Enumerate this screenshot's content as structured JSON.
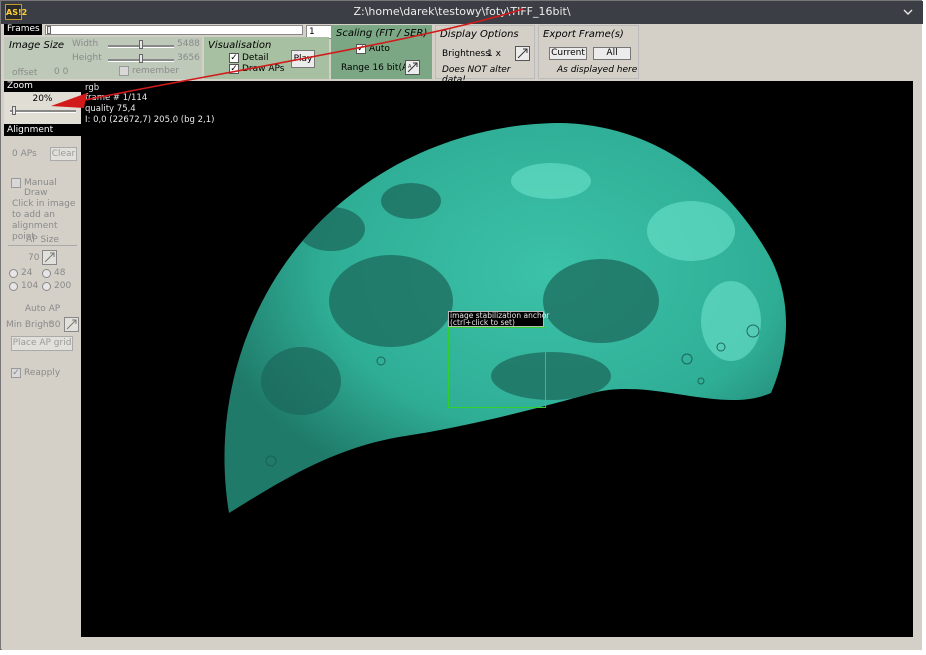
{
  "window": {
    "app_logo_text": "AS!2",
    "title": "Z:\\home\\darek\\testowy\\foty\\TIFF_16bit\\",
    "chevron_icon": "chevron-down-icon"
  },
  "frames": {
    "label": "Frames",
    "frame_number": "1",
    "slider_fraction": 0.0
  },
  "image_size": {
    "title": "Image Size",
    "width_label": "Width",
    "width_value": "5488",
    "height_label": "Height",
    "height_value": "3656",
    "remember_label": "remember",
    "offset_label": "offset",
    "offset_value": "0 0"
  },
  "visualisation": {
    "title": "Visualisation",
    "detail_label": "Detail",
    "draw_aps_label": "Draw APs",
    "play_label": "Play"
  },
  "scaling": {
    "title": "Scaling (FIT / SER)",
    "auto_label": "Auto",
    "range_label": "Range 16 bit(A)"
  },
  "display_options": {
    "title": "Display Options",
    "brightness_label": "Brightness",
    "brightness_value": "1 x",
    "note": "Does NOT alter data!"
  },
  "export_frames": {
    "title": "Export Frame(s)",
    "current_label": "Current",
    "all_label": "All",
    "note": "As displayed here"
  },
  "zoom": {
    "label": "Zoom",
    "value": "20%"
  },
  "alignment_points": {
    "label": "Alignment Points",
    "aps_count": "0 APs",
    "clear_label": "Clear",
    "manual_draw_label": "Manual Draw",
    "hint": [
      "Click in image",
      "to add an",
      "alignment point"
    ],
    "ap_size_label": "AP Size",
    "ap_size_value": "70",
    "radio_options": [
      "24",
      "48",
      "104",
      "200"
    ],
    "auto_ap_label": "Auto AP",
    "min_bright_label": "Min Bright",
    "min_bright_value": "30",
    "place_grid_label": "Place AP grid",
    "reapply_label": "Reapply"
  },
  "overlay": {
    "line1": "rgb",
    "line2": "frame # 1/114",
    "line3": "quality 75,4",
    "line4": "I: 0,0 (22672,7) 205,0 (bg 2,1)",
    "anchor_line1": "image stabilization anchor",
    "anchor_line2": "(ctrl+click to set)"
  },
  "colors": {
    "moon": "#2fae96",
    "anchor_box": "#31d02a",
    "annotation_arrow": "#d21a1a",
    "titlebar": "#3b3f45",
    "scaling_panel": "#7ba784",
    "visualisation_panel": "#a7c0a1"
  }
}
